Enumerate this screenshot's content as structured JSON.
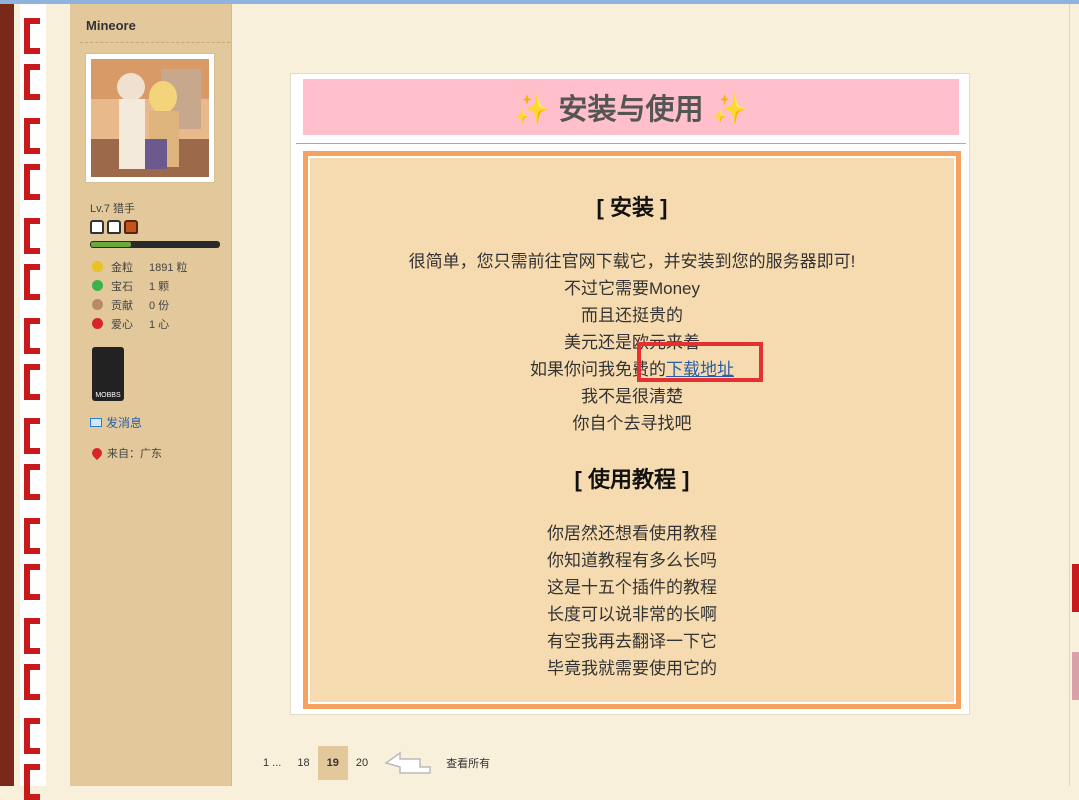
{
  "sidebar": {
    "username": "Mineore",
    "level": "Lv.7 猎手",
    "stats": [
      {
        "label": "金粒",
        "value": "1891 粒",
        "icon": "gold-nugget-icon",
        "color": "#e8c227"
      },
      {
        "label": "宝石",
        "value": "1 颗",
        "icon": "gem-icon",
        "color": "#3cb34a"
      },
      {
        "label": "贡献",
        "value": "0 份",
        "icon": "contribution-icon",
        "color": "#b88a6a"
      },
      {
        "label": "爱心",
        "value": "1 心",
        "icon": "heart-icon",
        "color": "#d7262a"
      }
    ],
    "badge_caption": "MOBBS",
    "message_label": "发消息",
    "from_label": "来自：广东"
  },
  "post": {
    "heading": "✨ 安装与使用 ✨",
    "section1_title": "[ 安装 ]",
    "section1_lines": [
      "很简单，您只需前往官网下载它，并安装到您的服务器即可!",
      "不过它需要Money",
      "而且还挺贵的",
      "美元还是欧元来着"
    ],
    "free_prefix": "如果你问我免费的",
    "download_link": "下载地址",
    "section1_lines2": [
      "我不是很清楚",
      "你自个去寻找吧"
    ],
    "section2_title": "[ 使用教程 ]",
    "section2_lines": [
      "你居然还想看使用教程",
      "你知道教程有多么长吗",
      "这是十五个插件的教程",
      "长度可以说非常的长啊",
      "有空我再去翻译一下它",
      "毕竟我就需要使用它的"
    ]
  },
  "pagination": {
    "first": "1 ...",
    "prev": "18",
    "current": "19",
    "next": "20",
    "view_all": "查看所有"
  },
  "colors": {
    "heading_bg": "#ffbfcb",
    "frame": "#f7a25f",
    "inner_bg": "#f6dbb0",
    "sidebar_bg": "#e2c89a",
    "highlight_box": "#e53032"
  }
}
